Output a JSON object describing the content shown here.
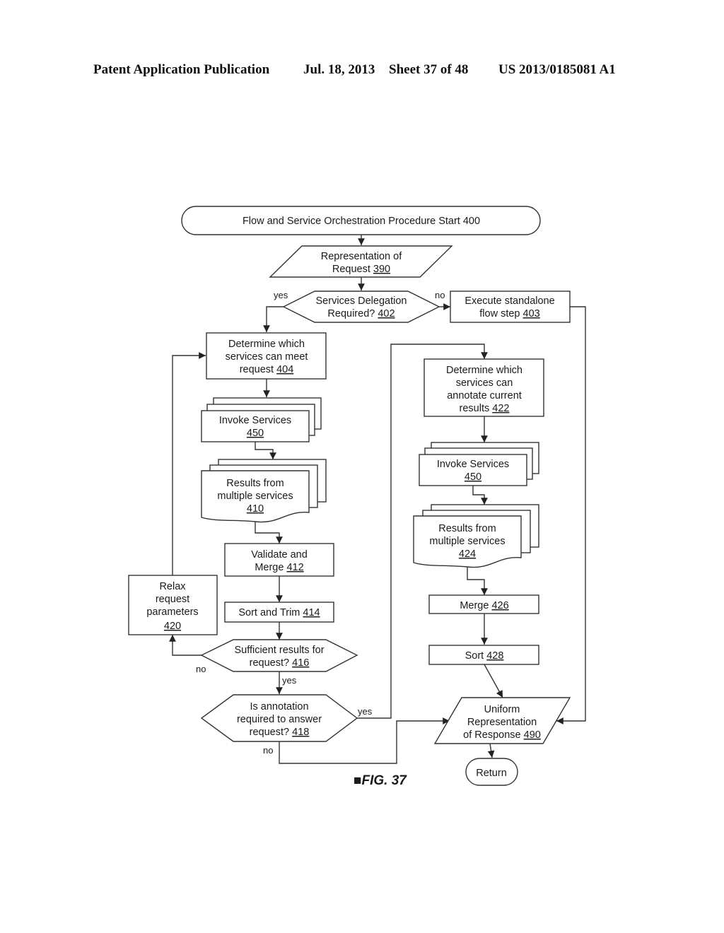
{
  "header": {
    "publication": "Patent Application Publication",
    "date": "Jul. 18, 2013",
    "sheet": "Sheet 37 of 48",
    "number": "US 2013/0185081 A1"
  },
  "figure": {
    "label": "FIG. 37",
    "marker": "■"
  },
  "nodes": {
    "start": {
      "lines": [
        "Flow and Service Orchestration Procedure Start 400"
      ],
      "ref": ""
    },
    "rep_request": {
      "lines": [
        "Representation of",
        "Request "
      ],
      "ref": "390"
    },
    "delegation": {
      "lines": [
        "Services Delegation",
        "Required? "
      ],
      "ref": "402"
    },
    "standalone": {
      "lines": [
        "Execute standalone",
        "flow step "
      ],
      "ref": "403"
    },
    "determine_meet": {
      "lines": [
        "Determine which",
        "services can meet",
        "request "
      ],
      "ref": "404"
    },
    "invoke_left": {
      "lines": [
        "Invoke Services",
        ""
      ],
      "ref": "450"
    },
    "results_left": {
      "lines": [
        "Results from",
        "multiple services",
        ""
      ],
      "ref": "410"
    },
    "validate": {
      "lines": [
        "Validate and",
        "Merge "
      ],
      "ref": "412"
    },
    "sort_trim": {
      "lines": [
        "Sort and Trim "
      ],
      "ref": "414"
    },
    "sufficient": {
      "lines": [
        "Sufficient results for",
        "request? "
      ],
      "ref": "416"
    },
    "annotation_req": {
      "lines": [
        "Is annotation",
        "required to answer",
        "request? "
      ],
      "ref": "418"
    },
    "relax": {
      "lines": [
        "Relax",
        "request",
        "parameters",
        ""
      ],
      "ref": "420"
    },
    "determine_annotate": {
      "lines": [
        "Determine which",
        "services can",
        "annotate current",
        "results "
      ],
      "ref": "422"
    },
    "invoke_right": {
      "lines": [
        "Invoke Services",
        ""
      ],
      "ref": "450"
    },
    "results_right": {
      "lines": [
        "Results from",
        "multiple services",
        ""
      ],
      "ref": "424"
    },
    "merge": {
      "lines": [
        "Merge "
      ],
      "ref": "426"
    },
    "sort": {
      "lines": [
        "Sort "
      ],
      "ref": "428"
    },
    "uniform": {
      "lines": [
        "Uniform",
        "Representation",
        "of Response "
      ],
      "ref": "490"
    },
    "return": {
      "lines": [
        "Return"
      ],
      "ref": ""
    }
  },
  "edge_labels": {
    "delegation_yes": "yes",
    "delegation_no": "no",
    "sufficient_no": "no",
    "sufficient_yes": "yes",
    "annotation_yes": "yes",
    "annotation_no": "no"
  }
}
